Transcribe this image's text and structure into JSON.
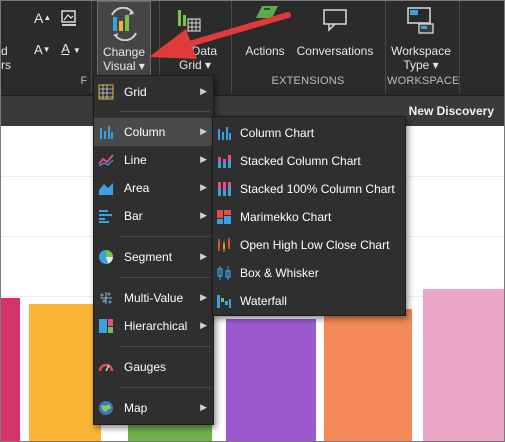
{
  "ribbon": {
    "left_partial": "d\nrs",
    "font_up": "A",
    "font_down": "A",
    "change_visual_line1": "Change",
    "change_visual_line2": "Visual ▾",
    "new_data_grid_line1": "ew Data",
    "new_data_grid_line2": "Grid ▾",
    "actions": "Actions",
    "conversations": "Conversations",
    "extensions_label": "EXTENSIONS",
    "workspace_type_line1": "Workspace",
    "workspace_type_line2": "Type ▾",
    "workspace_label": "WORKSPACE",
    "group_label_partial": "F",
    "new_discovery": "New Discovery"
  },
  "menu": {
    "items": [
      {
        "label": "Grid",
        "icon": "grid-icon",
        "has_submenu": true
      },
      {
        "label": "Column",
        "icon": "column-chart-icon",
        "has_submenu": true,
        "active": true
      },
      {
        "label": "Line",
        "icon": "line-chart-icon",
        "has_submenu": true
      },
      {
        "label": "Area",
        "icon": "area-chart-icon",
        "has_submenu": true
      },
      {
        "label": "Bar",
        "icon": "bar-chart-icon",
        "has_submenu": true
      },
      {
        "label": "Segment",
        "icon": "pie-chart-icon",
        "has_submenu": true
      },
      {
        "label": "Multi-Value",
        "icon": "scatter-icon",
        "has_submenu": true
      },
      {
        "label": "Hierarchical",
        "icon": "treemap-icon",
        "has_submenu": true
      },
      {
        "label": "Gauges",
        "icon": "gauge-icon",
        "has_submenu": false
      },
      {
        "label": "Map",
        "icon": "globe-icon",
        "has_submenu": true
      }
    ]
  },
  "submenu": {
    "items": [
      {
        "label": "Column Chart",
        "icon": "column-chart-icon"
      },
      {
        "label": "Stacked Column Chart",
        "icon": "stacked-column-icon"
      },
      {
        "label": "Stacked 100% Column Chart",
        "icon": "stacked-100-column-icon"
      },
      {
        "label": "Marimekko Chart",
        "icon": "marimekko-icon"
      },
      {
        "label": "Open High Low Close Chart",
        "icon": "ohlc-icon"
      },
      {
        "label": "Box & Whisker",
        "icon": "box-whisker-icon"
      },
      {
        "label": "Waterfall",
        "icon": "waterfall-icon"
      }
    ]
  },
  "colors": {
    "ribbon_bg": "#2b2b2b",
    "menu_bg": "#2f2f2f",
    "accent_arrow": "#e03a3a",
    "bars": [
      "#d6336c",
      "#fbb534",
      "#6fb24a",
      "#9b59d0",
      "#f48a5a",
      "#e9a6c6"
    ]
  }
}
